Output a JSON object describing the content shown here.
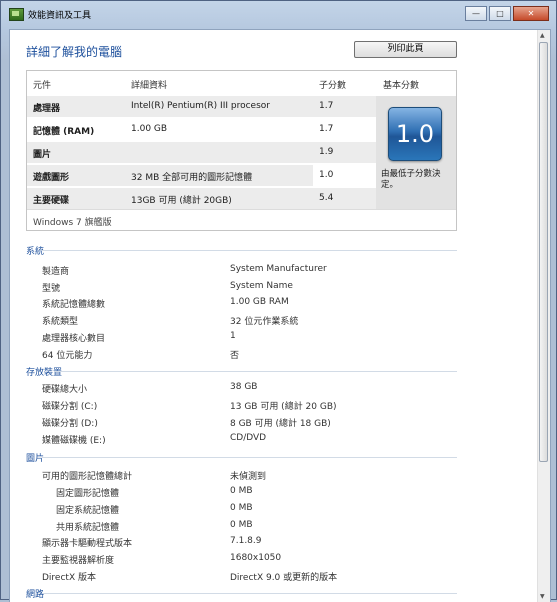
{
  "window": {
    "title": "效能資訊及工具",
    "minimize": "—",
    "maximize": "□",
    "close": "✕"
  },
  "header": {
    "title": "詳細了解我的電腦",
    "print_label": "列印此頁"
  },
  "score_table": {
    "headers": {
      "component": "元件",
      "details": "詳細資料",
      "subscore": "子分數",
      "base": "基本分數"
    },
    "rows": [
      {
        "name": "處理器",
        "details": "Intel(R) Pentium(R) III procesor",
        "score": "1.7"
      },
      {
        "name": "記憶體 (RAM)",
        "details": "1.00 GB",
        "score": "1.7"
      },
      {
        "name": "圖片",
        "details": "",
        "score": "1.9"
      },
      {
        "name": "遊戲圖形",
        "details": "32 MB 全部可用的圖形記憶體",
        "score": "1.0"
      },
      {
        "name": "主要硬碟",
        "details": "13GB 可用 (總計 20GB)",
        "score": "5.4"
      }
    ],
    "base_score": "1.0",
    "base_note": "由最低子分數決定。",
    "edition": "Windows 7 旗艦版"
  },
  "sections": {
    "system": {
      "title": "系統",
      "rows": [
        {
          "label": "製造商",
          "value": "System Manufacturer"
        },
        {
          "label": "型號",
          "value": "System Name"
        },
        {
          "label": "系統記憶體總數",
          "value": "1.00 GB RAM"
        },
        {
          "label": "系統類型",
          "value": "32 位元作業系統"
        },
        {
          "label": "處理器核心數目",
          "value": "1"
        },
        {
          "label": "64 位元能力",
          "value": "否"
        }
      ]
    },
    "storage": {
      "title": "存放裝置",
      "rows": [
        {
          "label": "硬碟總大小",
          "value": "38 GB"
        },
        {
          "label": "磁碟分割 (C:)",
          "value": "13 GB 可用 (總計 20 GB)"
        },
        {
          "label": "磁碟分割 (D:)",
          "value": "8 GB 可用 (總計 18 GB)"
        },
        {
          "label": "媒體磁碟機 (E:)",
          "value": "CD/DVD"
        }
      ]
    },
    "graphics": {
      "title": "圖片",
      "rows": [
        {
          "label": "可用的圖形記憶體總計",
          "value": "未偵測到"
        },
        {
          "label": "固定圖形記憶體",
          "value": "0 MB"
        },
        {
          "label": "固定系統記憶體",
          "value": "0 MB"
        },
        {
          "label": "共用系統記憶體",
          "value": "0 MB"
        },
        {
          "label": "顯示器卡驅動程式版本",
          "value": "7.1.8.9"
        },
        {
          "label": "主要監視器解析度",
          "value": "1680x1050"
        },
        {
          "label": "DirectX 版本",
          "value": "DirectX 9.0 或更新的版本"
        }
      ]
    },
    "network": {
      "title": "網路"
    }
  }
}
